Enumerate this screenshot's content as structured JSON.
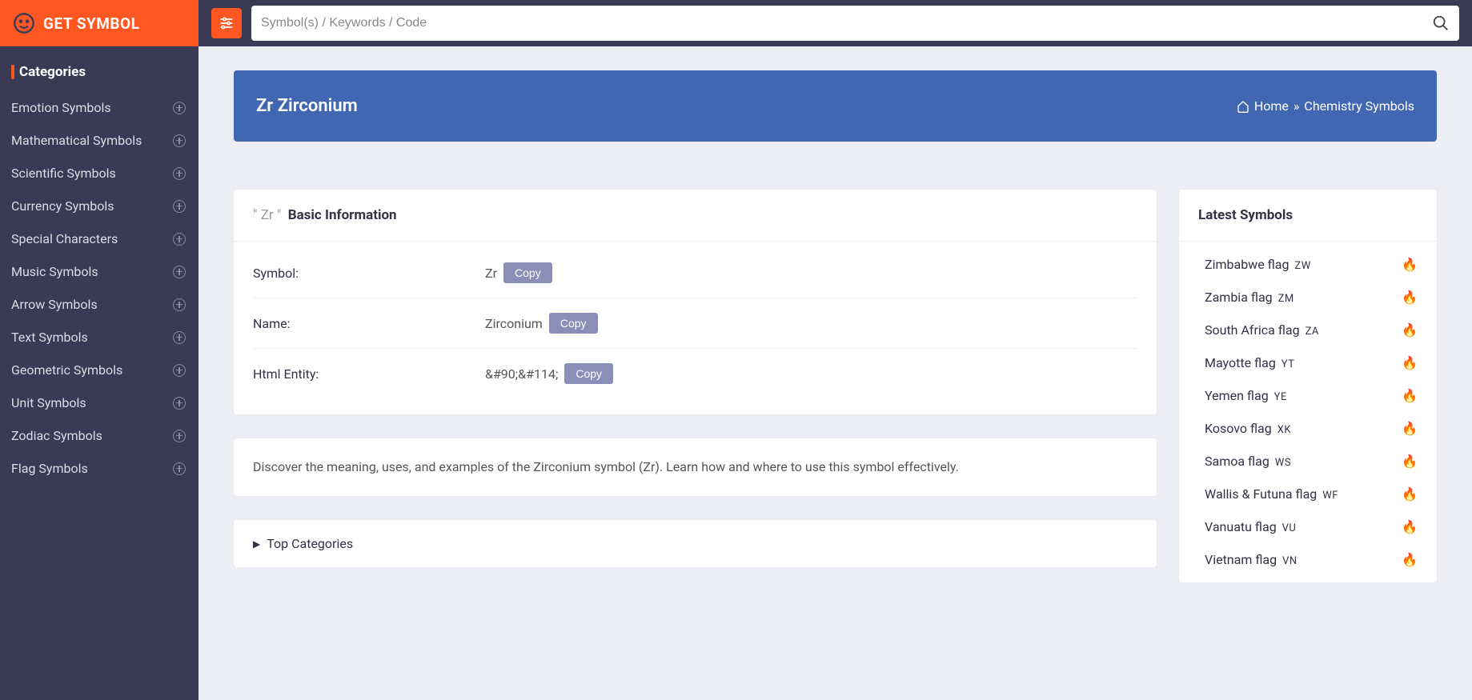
{
  "logo": {
    "text": "GET SYMBOL"
  },
  "categoriesHeader": "Categories",
  "sidebar": {
    "items": [
      {
        "label": "Emotion Symbols"
      },
      {
        "label": "Mathematical Symbols"
      },
      {
        "label": "Scientific Symbols"
      },
      {
        "label": "Currency Symbols"
      },
      {
        "label": "Special Characters"
      },
      {
        "label": "Music Symbols"
      },
      {
        "label": "Arrow Symbols"
      },
      {
        "label": "Text Symbols"
      },
      {
        "label": "Geometric Symbols"
      },
      {
        "label": "Unit Symbols"
      },
      {
        "label": "Zodiac Symbols"
      },
      {
        "label": "Flag Symbols"
      }
    ]
  },
  "search": {
    "placeholder": "Symbol(s) / Keywords / Code"
  },
  "banner": {
    "title": "Zr Zirconium",
    "breadcrumb": {
      "home": "Home",
      "sep": "»",
      "current": "Chemistry Symbols"
    }
  },
  "basicInfo": {
    "headerGray": "\" Zr \"",
    "headerBold": "Basic Information",
    "rows": {
      "symbol": {
        "label": "Symbol:",
        "value": "Zr"
      },
      "name": {
        "label": "Name:",
        "value": "Zirconium"
      },
      "entity": {
        "label": "Html Entity:",
        "value": "&#90;&#114;"
      }
    },
    "copyLabel": "Copy"
  },
  "description": "Discover the meaning, uses, and examples of the Zirconium symbol (Zr). Learn how and where to use this symbol effectively.",
  "topCategoriesLabel": "Top Categories",
  "latest": {
    "header": "Latest Symbols",
    "items": [
      {
        "label": "Zimbabwe flag",
        "code": "ZW"
      },
      {
        "label": "Zambia flag",
        "code": "ZM"
      },
      {
        "label": "South Africa flag",
        "code": "ZA"
      },
      {
        "label": "Mayotte flag",
        "code": "YT"
      },
      {
        "label": "Yemen flag",
        "code": "YE"
      },
      {
        "label": "Kosovo flag",
        "code": "XK"
      },
      {
        "label": "Samoa flag",
        "code": "WS"
      },
      {
        "label": "Wallis & Futuna flag",
        "code": "WF"
      },
      {
        "label": "Vanuatu flag",
        "code": "VU"
      },
      {
        "label": "Vietnam flag",
        "code": "VN"
      }
    ]
  }
}
